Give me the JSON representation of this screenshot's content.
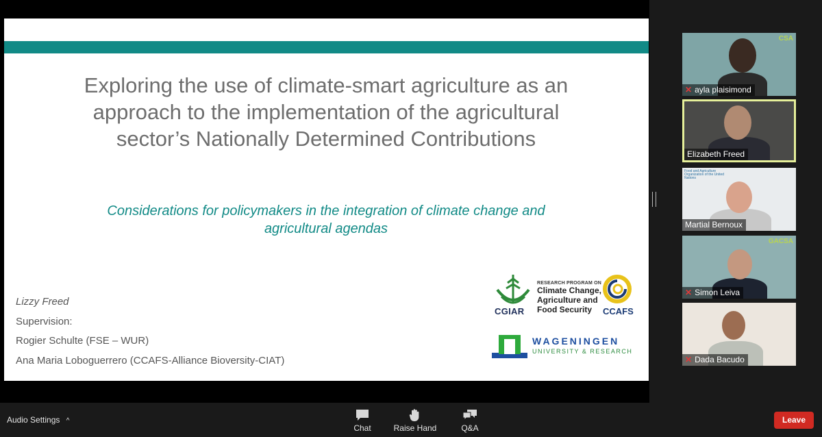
{
  "slide": {
    "title": "Exploring the use of climate-smart agriculture as an approach to the implementation of the agricultural sector’s Nationally Determined Contributions",
    "subtitle": "Considerations for policymakers in the integration of climate change and agricultural agendas",
    "author": "Lizzy Freed",
    "supervision_label": "Supervision:",
    "supervisor_1": "Rogier Schulte (FSE – WUR)",
    "supervisor_2": "Ana Maria Loboguerrero (CCAFS-Alliance Bioversity-CIAT)",
    "logos": {
      "cgiar": "CGIAR",
      "ccafs_program": "RESEARCH PROGRAM ON",
      "ccafs_line1": "Climate Change,",
      "ccafs_line2": "Agriculture and",
      "ccafs_line3": "Food Security",
      "ccafs": "CCAFS",
      "wur_name": "WAGENINGEN",
      "wur_sub": "UNIVERSITY & RESEARCH"
    },
    "band_color": "#118a86"
  },
  "participants": [
    {
      "name": "ayla plaisimond",
      "muted": true,
      "badge": "CSA"
    },
    {
      "name": "Elizabeth Freed",
      "muted": false,
      "active": true
    },
    {
      "name": "Martial Bernoux",
      "muted": false,
      "badge": "Food and Agriculture Organization of the United Nations"
    },
    {
      "name": "Simon Leiva",
      "muted": true,
      "badge": "GACSA"
    },
    {
      "name": "Dada Bacudo",
      "muted": true
    }
  ],
  "toolbar": {
    "audio_settings": "Audio Settings",
    "chat": "Chat",
    "raise_hand": "Raise Hand",
    "qa": "Q&A",
    "leave": "Leave"
  },
  "colors": {
    "leave": "#d12a22",
    "active_speaker": "#e6f09a",
    "accent": "#118a86"
  }
}
